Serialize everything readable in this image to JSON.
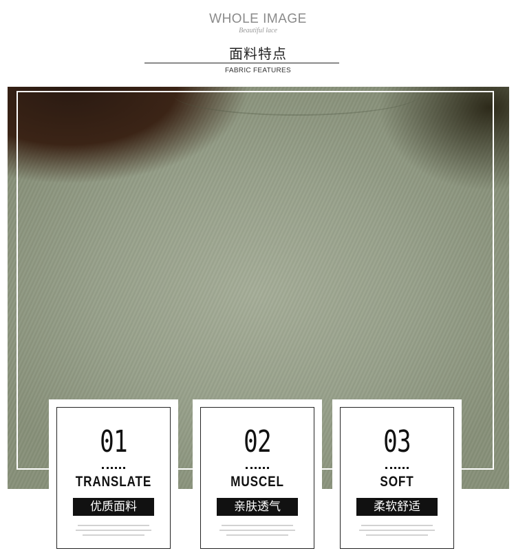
{
  "header": {
    "title_en": "WHOLE IMAGE",
    "script": "Beautiful lace",
    "title_cn": "面料特点",
    "subtitle_en": "FABRIC FEATURES"
  },
  "features": [
    {
      "number": "01",
      "label_en": "TRANSLATE",
      "label_cn": "优质面料"
    },
    {
      "number": "02",
      "label_en": "MUSCEL",
      "label_cn": "亲肤透气"
    },
    {
      "number": "03",
      "label_en": "SOFT",
      "label_cn": "柔软舒适"
    }
  ],
  "colors": {
    "fabric": "#9aa38c",
    "accent": "#111111"
  }
}
